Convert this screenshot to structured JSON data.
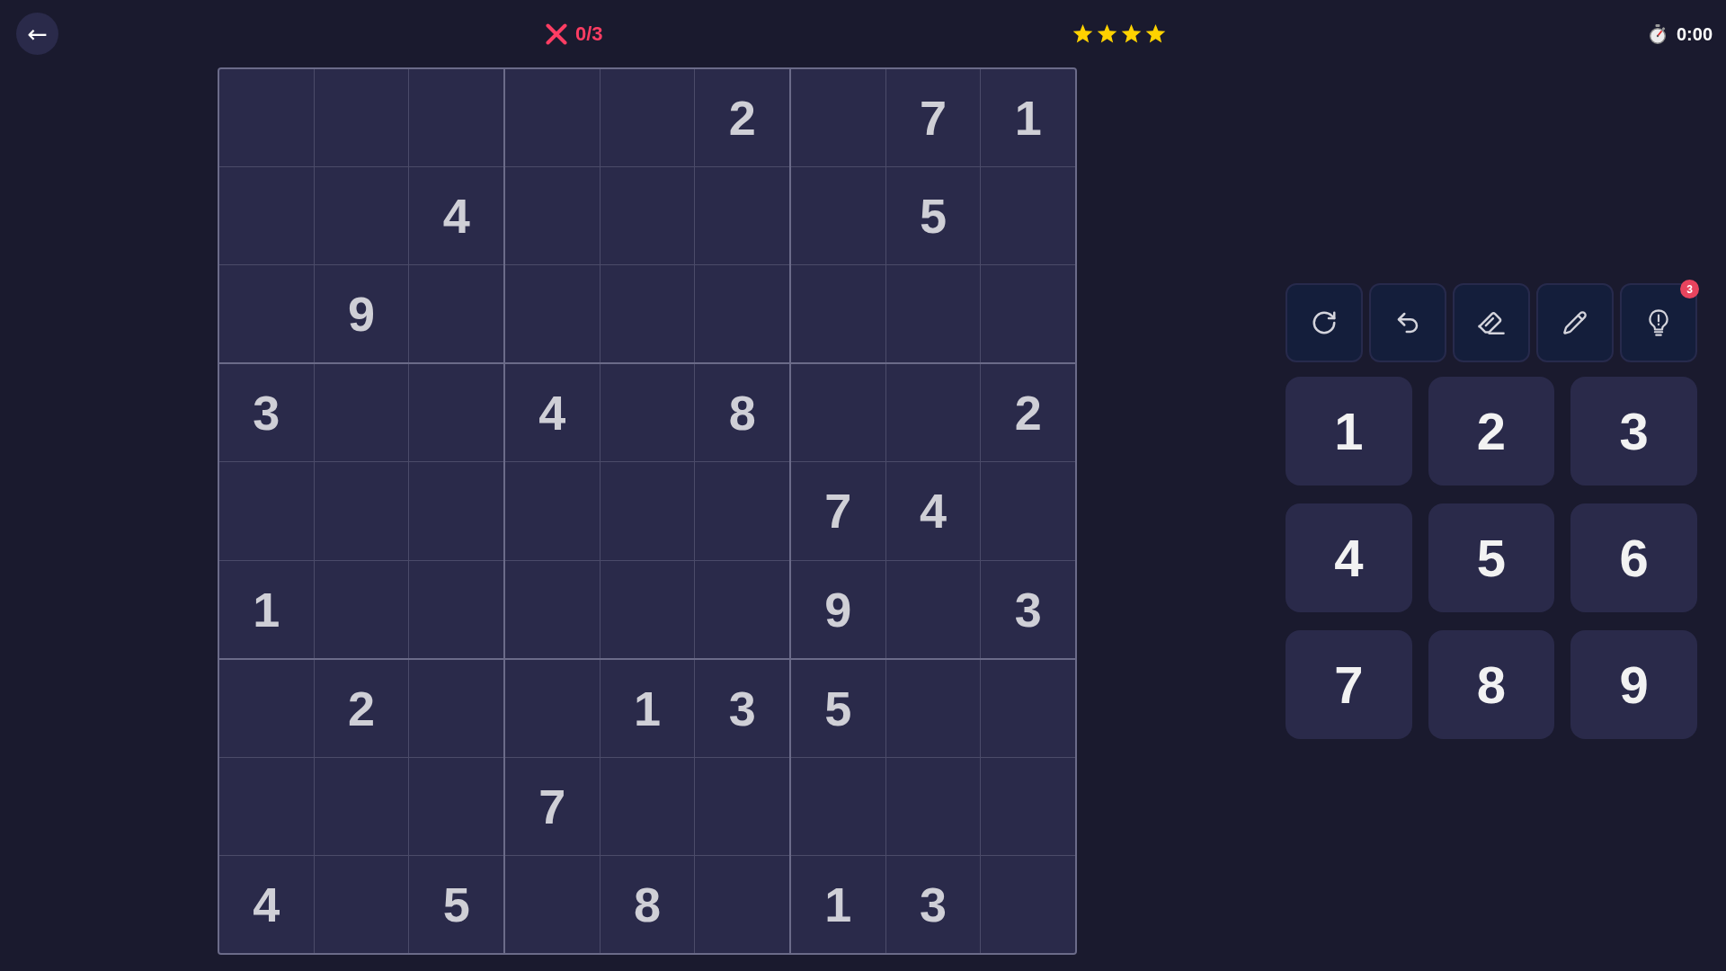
{
  "header": {
    "back": "←",
    "mistakes": "0/3",
    "stars": 4,
    "timer": "0:00"
  },
  "board": {
    "rows": [
      [
        null,
        null,
        null,
        null,
        null,
        "2",
        null,
        "7",
        "1"
      ],
      [
        null,
        null,
        "4",
        null,
        null,
        null,
        null,
        "5",
        null
      ],
      [
        null,
        "9",
        null,
        null,
        null,
        null,
        null,
        null,
        null
      ],
      [
        "3",
        null,
        null,
        "4",
        null,
        "8",
        null,
        null,
        "2"
      ],
      [
        null,
        null,
        null,
        null,
        null,
        null,
        "7",
        "4",
        null
      ],
      [
        "1",
        null,
        null,
        null,
        null,
        null,
        "9",
        null,
        "3"
      ],
      [
        null,
        "2",
        null,
        null,
        "1",
        "3",
        "5",
        null,
        null
      ],
      [
        null,
        null,
        null,
        "7",
        null,
        null,
        null,
        null,
        null
      ],
      [
        "4",
        null,
        "5",
        null,
        "8",
        null,
        "1",
        "3",
        null
      ]
    ]
  },
  "toolbar": {
    "hint_count": "3"
  },
  "number_pad": [
    "1",
    "2",
    "3",
    "4",
    "5",
    "6",
    "7",
    "8",
    "9"
  ]
}
